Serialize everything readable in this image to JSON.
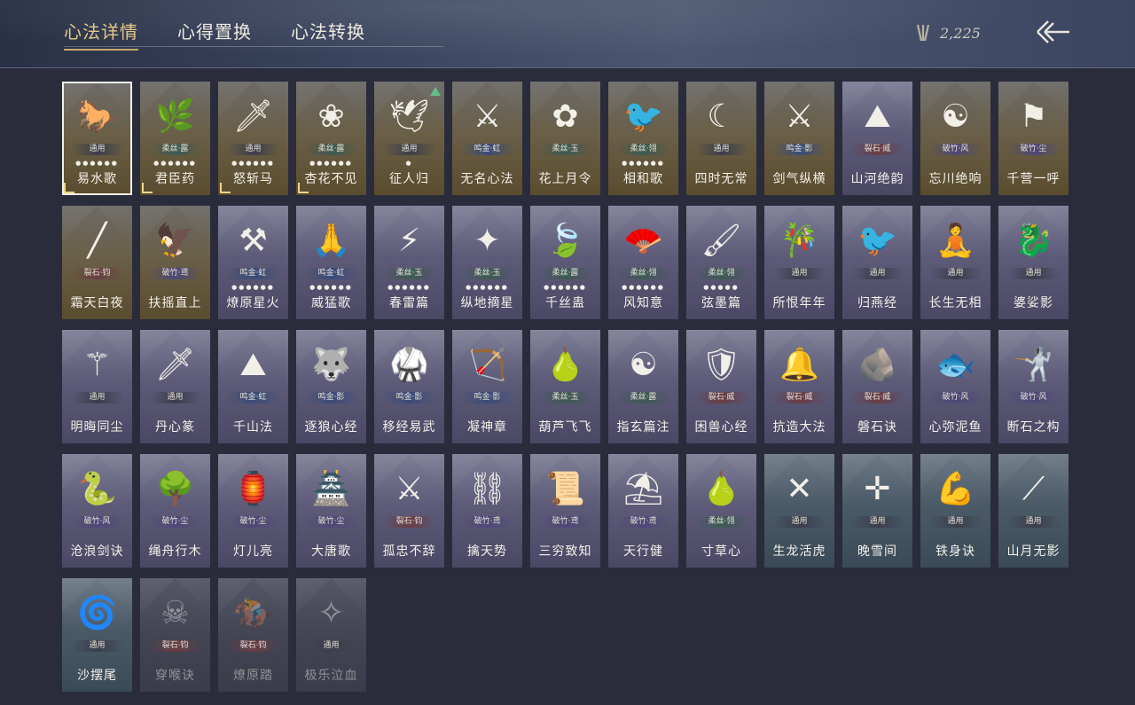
{
  "tabs": [
    {
      "label": "心法详情",
      "active": true
    },
    {
      "label": "心得置换",
      "active": false
    },
    {
      "label": "心法转换",
      "active": false
    }
  ],
  "currency": {
    "icon": "arrows-currency-icon",
    "value": "2,225"
  },
  "back_icon": "back-arrow-icon",
  "cards": [
    {
      "name": "易水歌",
      "tag": "通用",
      "dots": "●●●●●●",
      "style": "gold",
      "tagc": "c-gray",
      "icon": "horse-icon",
      "glyph": "🐎",
      "selected": true,
      "corner": true
    },
    {
      "name": "君臣药",
      "tag": "柔丝·露",
      "dots": "●●●●●●",
      "style": "gold",
      "tagc": "c-green",
      "icon": "herb-bowl-icon",
      "glyph": "🌿",
      "corner": true
    },
    {
      "name": "怒斩马",
      "tag": "通用",
      "dots": "●●●●●●",
      "style": "gold",
      "tagc": "c-gray",
      "icon": "blade-icon",
      "glyph": "🗡",
      "corner": true
    },
    {
      "name": "杏花不见",
      "tag": "柔丝·露",
      "dots": "●●●●●●",
      "style": "gold",
      "tagc": "c-green",
      "icon": "blossom-icon",
      "glyph": "❀",
      "corner": true
    },
    {
      "name": "征人归",
      "tag": "通用",
      "dots": "●",
      "style": "gold",
      "tagc": "c-gray",
      "icon": "bird-hand-icon",
      "glyph": "🕊",
      "new": true
    },
    {
      "name": "无名心法",
      "tag": "鸣金·虹",
      "dots": "",
      "style": "gold",
      "tagc": "c-blue",
      "icon": "sword-icon",
      "glyph": "⚔"
    },
    {
      "name": "花上月令",
      "tag": "柔丝·玉",
      "dots": "",
      "style": "gold",
      "tagc": "c-green",
      "icon": "moon-flower-icon",
      "glyph": "✿"
    },
    {
      "name": "相和歌",
      "tag": "柔丝·翎",
      "dots": "●●●●●●",
      "style": "gold",
      "tagc": "c-green",
      "icon": "bird-pair-icon",
      "glyph": "🐦"
    },
    {
      "name": "四时无常",
      "tag": "通用",
      "dots": "",
      "style": "gold",
      "tagc": "c-gray",
      "icon": "moon-icon",
      "glyph": "☾"
    },
    {
      "name": "剑气纵横",
      "tag": "鸣金·影",
      "dots": "",
      "style": "gold",
      "tagc": "c-blue",
      "icon": "sword-cross-icon",
      "glyph": "⚔"
    },
    {
      "name": "山河绝韵",
      "tag": "裂石·威",
      "dots": "",
      "style": "purple",
      "tagc": "c-red",
      "icon": "mountain-icon",
      "glyph": "⛰"
    },
    {
      "name": "忘川绝响",
      "tag": "破竹·风",
      "dots": "",
      "style": "gold",
      "tagc": "c-purple",
      "icon": "mask-icon",
      "glyph": "☯"
    },
    {
      "name": "千营一呼",
      "tag": "破竹·尘",
      "dots": "",
      "style": "gold",
      "tagc": "c-purple",
      "icon": "flag-icon",
      "glyph": "⚑"
    },
    {
      "name": "霜天白夜",
      "tag": "裂石·钧",
      "dots": "",
      "style": "gold",
      "tagc": "c-red",
      "icon": "spear-icon",
      "glyph": "╱"
    },
    {
      "name": "扶摇直上",
      "tag": "破竹·鸢",
      "dots": "",
      "style": "gold",
      "tagc": "c-purple",
      "icon": "eagle-icon",
      "glyph": "🦅"
    },
    {
      "name": "燎原星火",
      "tag": "鸣金·虹",
      "dots": "●●●●●●",
      "style": "purple",
      "tagc": "c-blue",
      "icon": "scythe-icon",
      "glyph": "⚒"
    },
    {
      "name": "威猛歌",
      "tag": "鸣金·虹",
      "dots": "●●●●●●",
      "style": "purple",
      "tagc": "c-blue",
      "icon": "praying-hands-icon",
      "glyph": "🙏"
    },
    {
      "name": "春雷篇",
      "tag": "柔丝·玉",
      "dots": "●●●●●●",
      "style": "purple",
      "tagc": "c-green",
      "icon": "thunder-tree-icon",
      "glyph": "⚡"
    },
    {
      "name": "纵地摘星",
      "tag": "柔丝·玉",
      "dots": "●●●●●●",
      "style": "purple",
      "tagc": "c-green",
      "icon": "star-catch-icon",
      "glyph": "✦"
    },
    {
      "name": "千丝蛊",
      "tag": "柔丝·露",
      "dots": "●●●●●●",
      "style": "purple",
      "tagc": "c-green",
      "icon": "leaf-icon",
      "glyph": "🍃"
    },
    {
      "name": "风知意",
      "tag": "柔丝·翎",
      "dots": "●●●●●●",
      "style": "purple",
      "tagc": "c-green",
      "icon": "fan-icon",
      "glyph": "🪭"
    },
    {
      "name": "弦墨篇",
      "tag": "柔丝·翎",
      "dots": "●●●●●",
      "style": "purple",
      "tagc": "c-green",
      "icon": "brush-icon",
      "glyph": "🖌"
    },
    {
      "name": "所恨年年",
      "tag": "通用",
      "dots": "",
      "style": "purple",
      "tagc": "c-gray",
      "icon": "bamboo-icon",
      "glyph": "🎋"
    },
    {
      "name": "归燕经",
      "tag": "通用",
      "dots": "",
      "style": "purple",
      "tagc": "c-gray",
      "icon": "swallow-icon",
      "glyph": "🐦"
    },
    {
      "name": "长生无相",
      "tag": "通用",
      "dots": "",
      "style": "purple",
      "tagc": "c-gray",
      "icon": "figure-icon",
      "glyph": "🧘"
    },
    {
      "name": "婆娑影",
      "tag": "通用",
      "dots": "",
      "style": "purple",
      "tagc": "c-gray",
      "icon": "dragon-icon",
      "glyph": "🐉"
    },
    {
      "name": "明晦同尘",
      "tag": "通用",
      "dots": "",
      "style": "purple",
      "tagc": "c-gray",
      "icon": "snake-sword-icon",
      "glyph": "⚚"
    },
    {
      "name": "丹心篆",
      "tag": "通用",
      "dots": "",
      "style": "purple",
      "tagc": "c-gray",
      "icon": "rock-sword-icon",
      "glyph": "🗡"
    },
    {
      "name": "千山法",
      "tag": "鸣金·虹",
      "dots": "",
      "style": "purple",
      "tagc": "c-blue",
      "icon": "peaks-icon",
      "glyph": "⛰"
    },
    {
      "name": "逐狼心经",
      "tag": "鸣金·影",
      "dots": "",
      "style": "purple",
      "tagc": "c-blue",
      "icon": "wolf-icon",
      "glyph": "🐺"
    },
    {
      "name": "移经易武",
      "tag": "鸣金·影",
      "dots": "",
      "style": "purple",
      "tagc": "c-blue",
      "icon": "warrior-icon",
      "glyph": "🥋"
    },
    {
      "name": "凝神章",
      "tag": "鸣金·影",
      "dots": "",
      "style": "purple",
      "tagc": "c-blue",
      "icon": "bow-icon",
      "glyph": "🏹"
    },
    {
      "name": "葫芦飞飞",
      "tag": "柔丝·玉",
      "dots": "",
      "style": "purple",
      "tagc": "c-green",
      "icon": "gourd-icon",
      "glyph": "🍐"
    },
    {
      "name": "指玄篇注",
      "tag": "柔丝·露",
      "dots": "",
      "style": "purple",
      "tagc": "c-green",
      "icon": "yin-yang-icon",
      "glyph": "☯"
    },
    {
      "name": "困兽心经",
      "tag": "裂石·威",
      "dots": "",
      "style": "purple",
      "tagc": "c-red",
      "icon": "shield-icon",
      "glyph": "🛡"
    },
    {
      "name": "抗造大法",
      "tag": "裂石·威",
      "dots": "",
      "style": "purple",
      "tagc": "c-red",
      "icon": "bell-icon",
      "glyph": "🔔"
    },
    {
      "name": "磐石诀",
      "tag": "裂石·威",
      "dots": "",
      "style": "purple",
      "tagc": "c-red",
      "icon": "boulder-icon",
      "glyph": "🪨"
    },
    {
      "name": "心弥泥鱼",
      "tag": "破竹·风",
      "dots": "",
      "style": "purple",
      "tagc": "c-purple",
      "icon": "fish-icon",
      "glyph": "🐟"
    },
    {
      "name": "断石之构",
      "tag": "破竹·风",
      "dots": "",
      "style": "purple",
      "tagc": "c-purple",
      "icon": "swordsman-icon",
      "glyph": "🤺"
    },
    {
      "name": "沧浪剑诀",
      "tag": "破竹·风",
      "dots": "",
      "style": "purple",
      "tagc": "c-purple",
      "icon": "serpent-icon",
      "glyph": "🐍"
    },
    {
      "name": "绳舟行木",
      "tag": "破竹·尘",
      "dots": "",
      "style": "purple",
      "tagc": "c-purple",
      "icon": "tree-roots-icon",
      "glyph": "🌳"
    },
    {
      "name": "灯儿亮",
      "tag": "破竹·尘",
      "dots": "",
      "style": "purple",
      "tagc": "c-purple",
      "icon": "lantern-icon",
      "glyph": "🏮"
    },
    {
      "name": "大唐歌",
      "tag": "破竹·尘",
      "dots": "",
      "style": "purple",
      "tagc": "c-purple",
      "icon": "city-icon",
      "glyph": "🏯"
    },
    {
      "name": "孤忠不辞",
      "tag": "裂石·钧",
      "dots": "",
      "style": "purple",
      "tagc": "c-red",
      "icon": "crossed-swords-icon",
      "glyph": "⚔"
    },
    {
      "name": "擒天势",
      "tag": "破竹·鸢",
      "dots": "",
      "style": "purple",
      "tagc": "c-purple",
      "icon": "chain-icon",
      "glyph": "⛓"
    },
    {
      "name": "三穷致知",
      "tag": "破竹·鸢",
      "dots": "",
      "style": "purple",
      "tagc": "c-purple",
      "icon": "scroll-icon",
      "glyph": "📜"
    },
    {
      "name": "天行健",
      "tag": "破竹·鸢",
      "dots": "",
      "style": "purple",
      "tagc": "c-purple",
      "icon": "hat-icon",
      "glyph": "⛱"
    },
    {
      "name": "寸草心",
      "tag": "柔丝·翎",
      "dots": "",
      "style": "purple",
      "tagc": "c-green",
      "icon": "fruit-icon",
      "glyph": "🍐"
    },
    {
      "name": "生龙活虎",
      "tag": "通用",
      "dots": "",
      "style": "teal",
      "tagc": "c-gray",
      "icon": "martial-icon",
      "glyph": "✕"
    },
    {
      "name": "晚雪间",
      "tag": "通用",
      "dots": "",
      "style": "teal",
      "tagc": "c-gray",
      "icon": "cross-circle-icon",
      "glyph": "✛"
    },
    {
      "name": "铁身诀",
      "tag": "通用",
      "dots": "",
      "style": "teal",
      "tagc": "c-gray",
      "icon": "strongman-icon",
      "glyph": "💪"
    },
    {
      "name": "山月无影",
      "tag": "通用",
      "dots": "",
      "style": "teal",
      "tagc": "c-gray",
      "icon": "slash-icon",
      "glyph": "⟋"
    },
    {
      "name": "沙摆尾",
      "tag": "通用",
      "dots": "",
      "style": "teal",
      "tagc": "c-gray",
      "icon": "swirl-icon",
      "glyph": "🌀"
    },
    {
      "name": "穿喉诀",
      "tag": "裂石·钧",
      "dots": "",
      "style": "dim",
      "tagc": "c-red",
      "icon": "pierce-icon",
      "glyph": "☠"
    },
    {
      "name": "燎原踏",
      "tag": "裂石·钧",
      "dots": "",
      "style": "dim",
      "tagc": "c-red",
      "icon": "rider-icon",
      "glyph": "🏇"
    },
    {
      "name": "极乐泣血",
      "tag": "通用",
      "dots": "",
      "style": "dim",
      "tagc": "c-gray",
      "icon": "blade-fan-icon",
      "glyph": "✧"
    }
  ]
}
